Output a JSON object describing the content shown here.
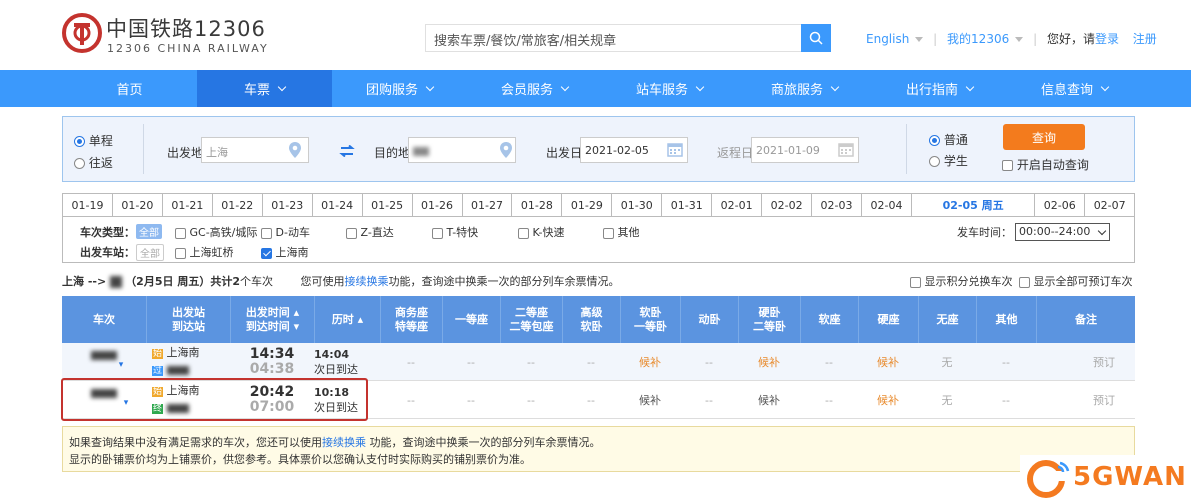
{
  "header": {
    "logo_cn": "中国铁路12306",
    "logo_en": "12306 CHINA RAILWAY",
    "search_placeholder": "搜索车票/餐饮/常旅客/相关规章",
    "lang": "English",
    "my12306": "我的12306",
    "greeting": "您好，请",
    "login": "登录",
    "register": "注册"
  },
  "nav": [
    "首页",
    "车票",
    "团购服务",
    "会员服务",
    "站车服务",
    "商旅服务",
    "出行指南",
    "信息查询"
  ],
  "form": {
    "oneway": "单程",
    "roundtrip": "往返",
    "from_label": "出发地",
    "from_value": "上海",
    "to_label": "目的地",
    "depart_label": "出发日",
    "depart_value": "2021-02-05",
    "return_label": "返程日",
    "return_value": "2021-01-09",
    "normal": "普通",
    "student": "学生",
    "query": "查询",
    "auto_query": "开启自动查询"
  },
  "dates": [
    "01-19",
    "01-20",
    "01-21",
    "01-22",
    "01-23",
    "01-24",
    "01-25",
    "01-26",
    "01-27",
    "01-28",
    "01-29",
    "01-30",
    "01-31",
    "02-01",
    "02-02",
    "02-03",
    "02-04",
    "02-05 周五",
    "02-06",
    "02-07"
  ],
  "filter": {
    "type_label": "车次类型：",
    "all": "全部",
    "types": [
      "GC-高铁/城际",
      "D-动车",
      "Z-直达",
      "T-特快",
      "K-快速",
      "其他"
    ],
    "station_label": "出发车站：",
    "stations": [
      "上海虹桥",
      "上海南"
    ],
    "time_label": "发车时间：",
    "time_value": "00:00--24:00"
  },
  "info": {
    "route": "上海 -->",
    "date": "（2月5日  周五）共计",
    "count": "2",
    "unit": "个车次",
    "hint1": "您可使用",
    "hint_link": "接续换乘",
    "hint2": "功能，查询途中换乘一次的部分列车余票情况。",
    "opt1": "显示积分兑换车次",
    "opt2": "显示全部可预订车次"
  },
  "table": {
    "headers": [
      [
        "车次"
      ],
      [
        "出发站",
        "到达站"
      ],
      [
        "出发时间 ▴",
        "到达时间 ▾"
      ],
      [
        "历时 ▴"
      ],
      [
        "商务座",
        "特等座"
      ],
      [
        "一等座"
      ],
      [
        "二等座",
        "二等包座"
      ],
      [
        "高级",
        "软卧"
      ],
      [
        "软卧",
        "一等卧"
      ],
      [
        "动卧"
      ],
      [
        "硬卧",
        "二等卧"
      ],
      [
        "软座"
      ],
      [
        "硬座"
      ],
      [
        "无座"
      ],
      [
        "其他"
      ],
      [
        "备注"
      ]
    ],
    "rows": [
      {
        "from_tag": "始",
        "from": "上海南",
        "to_tag": "过",
        "dep": "14:34",
        "arr": "04:38",
        "dur": "14:04",
        "arrive_note": "次日到达",
        "seats": [
          "--",
          "--",
          "--",
          "--",
          "候补",
          "--",
          "候补",
          "--",
          "候补",
          "无",
          "--"
        ],
        "action": "预订"
      },
      {
        "from_tag": "始",
        "from": "上海南",
        "to_tag": "终",
        "dep": "20:42",
        "arr": "07:00",
        "dur": "10:18",
        "arrive_note": "次日到达",
        "seats": [
          "--",
          "--",
          "--",
          "--",
          "候补",
          "--",
          "候补",
          "--",
          "候补",
          "无",
          "--"
        ],
        "action": "预订"
      }
    ]
  },
  "notice": {
    "line1a": "如果查询结果中没有满足需求的车次，您还可以使用",
    "link": "接续换乘",
    "line1b": " 功能，查询途中换乘一次的部分列车余票情况。",
    "line2": "显示的卧铺票价均为上铺票价，供您参考。具体票价以您确认支付时实际购买的铺别票价为准。"
  },
  "watermark": "5GWAN",
  "colors": {
    "brand": "#3b99fc",
    "nav_active": "#2676e3",
    "accent": "#f37b1d",
    "logo_red": "#c4332e"
  }
}
